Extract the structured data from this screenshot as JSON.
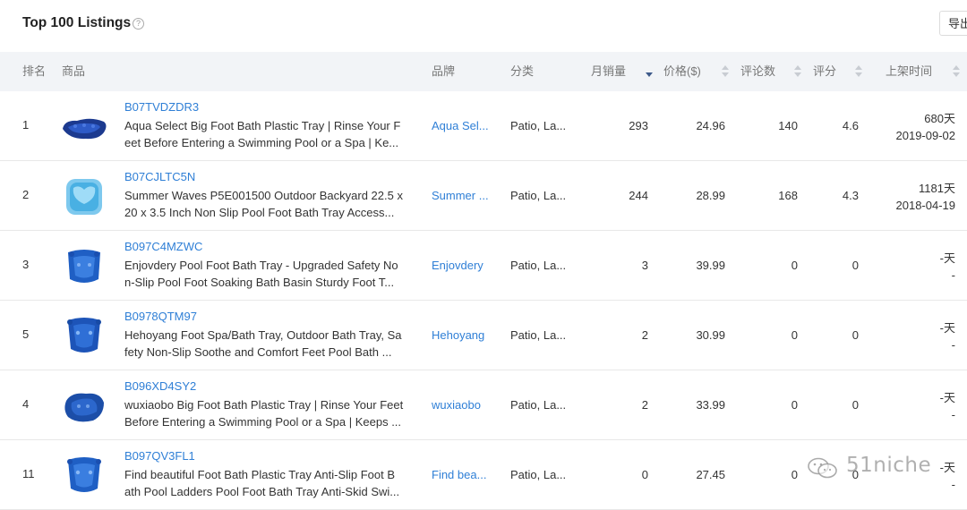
{
  "header": {
    "title": "Top 100 Listings",
    "help_icon": "question-circle-icon",
    "export_label": "导出"
  },
  "columns": {
    "rank": "排名",
    "product": "商品",
    "brand": "品牌",
    "category": "分类",
    "monthly_sales": "月销量",
    "price": "价格($)",
    "reviews": "评论数",
    "rating": "评分",
    "listed": "上架时间"
  },
  "rows": [
    {
      "rank": "1",
      "asin": "B07TVDZDR3",
      "title_line1": "Aqua Select Big Foot Bath Plastic Tray | Rinse Your F",
      "title_line2": "eet Before Entering a Swimming Pool or a Spa | Ke...",
      "brand": "Aqua Sel...",
      "category": "Patio, La...",
      "sales": "293",
      "price": "24.96",
      "reviews": "140",
      "rating": "4.6",
      "days": "680天",
      "date": "2019-09-02"
    },
    {
      "rank": "2",
      "asin": "B07CJLTC5N",
      "title_line1": "Summer Waves P5E001500 Outdoor Backyard 22.5 x",
      "title_line2": "20 x 3.5 Inch Non Slip Pool Foot Bath Tray Access...",
      "brand": "Summer ...",
      "category": "Patio, La...",
      "sales": "244",
      "price": "28.99",
      "reviews": "168",
      "rating": "4.3",
      "days": "1181天",
      "date": "2018-04-19"
    },
    {
      "rank": "3",
      "asin": "B097C4MZWC",
      "title_line1": "Enjovdery Pool Foot Bath Tray - Upgraded Safety No",
      "title_line2": "n-Slip Pool Foot Soaking Bath Basin Sturdy Foot T...",
      "brand": "Enjovdery",
      "category": "Patio, La...",
      "sales": "3",
      "price": "39.99",
      "reviews": "0",
      "rating": "0",
      "days": "-天",
      "date": "-"
    },
    {
      "rank": "5",
      "asin": "B0978QTM97",
      "title_line1": "Hehoyang Foot Spa/Bath Tray, Outdoor Bath Tray, Sa",
      "title_line2": "fety Non-Slip Soothe and Comfort Feet Pool Bath ...",
      "brand": "Hehoyang",
      "category": "Patio, La...",
      "sales": "2",
      "price": "30.99",
      "reviews": "0",
      "rating": "0",
      "days": "-天",
      "date": "-"
    },
    {
      "rank": "4",
      "asin": "B096XD4SY2",
      "title_line1": "wuxiaobo Big Foot Bath Plastic Tray | Rinse Your Feet",
      "title_line2": "Before Entering a Swimming Pool or a Spa | Keeps ...",
      "brand": "wuxiaobo",
      "category": "Patio, La...",
      "sales": "2",
      "price": "33.99",
      "reviews": "0",
      "rating": "0",
      "days": "-天",
      "date": "-"
    },
    {
      "rank": "11",
      "asin": "B097QV3FL1",
      "title_line1": "Find beautiful Foot Bath Plastic Tray Anti-Slip Foot B",
      "title_line2": "ath Pool Ladders Pool Foot Bath Tray Anti-Skid Swi...",
      "brand": "Find bea...",
      "category": "Patio, La...",
      "sales": "0",
      "price": "27.45",
      "reviews": "0",
      "rating": "0",
      "days": "-天",
      "date": "-"
    }
  ],
  "colors": {
    "link": "#2f7fd6",
    "header_bg": "#f2f4f7",
    "tray_blue": "#1f5fc4"
  },
  "watermark": {
    "text": "51niche",
    "icon": "wechat-icon"
  }
}
